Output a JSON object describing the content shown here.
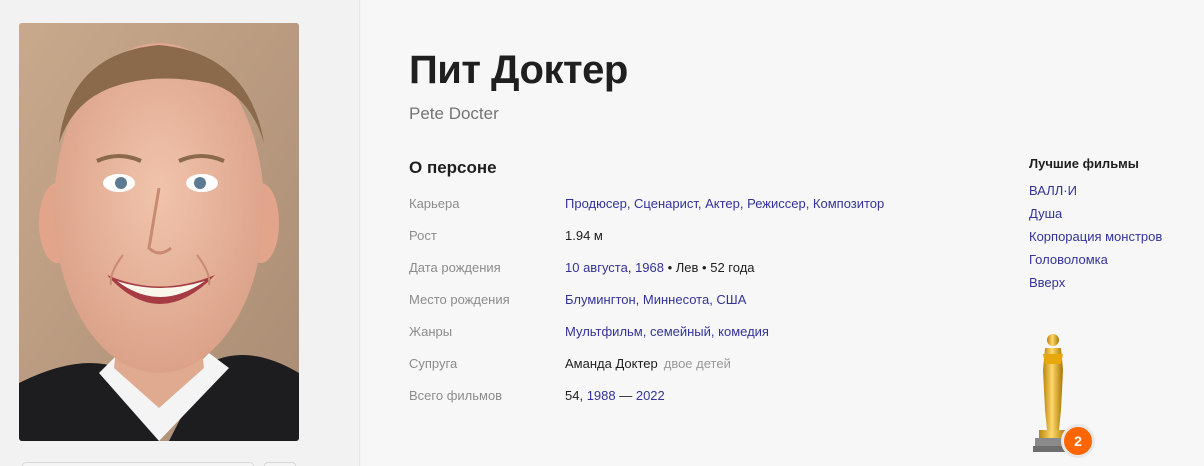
{
  "person": {
    "name_ru": "Пит Доктер",
    "name_en": "Pete Docter"
  },
  "about": {
    "heading": "О персоне",
    "rows": [
      {
        "label": "Карьера",
        "value": "Продюсер, Сценарист, Актер, Режиссер, Композитор"
      },
      {
        "label": "Рост",
        "value": "1.94 м"
      },
      {
        "label": "Дата рождения",
        "date_link": "10 августа",
        "sep1": ", ",
        "year_link": "1968",
        "sign": " • Лев • ",
        "age": "52 года"
      },
      {
        "label": "Место рождения",
        "value": "Блумингтон, Миннесота, США"
      },
      {
        "label": "Жанры",
        "value": "Мультфильм, семейный, комедия"
      },
      {
        "label": "Супруга",
        "value": "Аманда Доктер",
        "note": "двое детей"
      },
      {
        "label": "Всего фильмов",
        "count": "54, ",
        "from_link": "1988",
        "dash": " — ",
        "to_link": "2022"
      }
    ]
  },
  "best_films": {
    "heading": "Лучшие фильмы",
    "items": [
      "ВАЛЛ·И",
      "Душа",
      "Корпорация монстров",
      "Головоломка",
      "Вверх"
    ]
  },
  "awards": {
    "oscar_count": "2"
  },
  "colors": {
    "link": "#333399",
    "badge": "#ff6600"
  }
}
